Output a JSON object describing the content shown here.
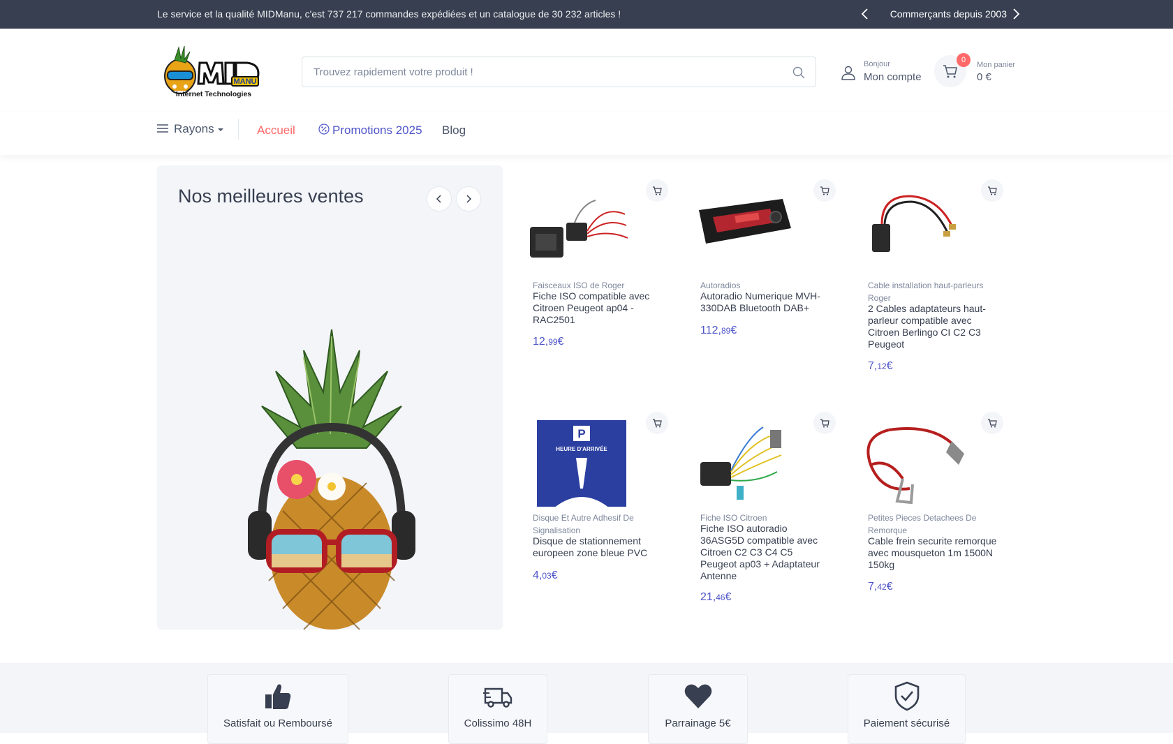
{
  "topbar": {
    "message": "Le service et la qualité MIDManu, c'est 737 217 commandes expédiées et un catalogue de 30 232 articles !",
    "since": "Commerçants depuis 2003"
  },
  "header": {
    "logo_text": "MIDManu Internet Technologies",
    "search_placeholder": "Trouvez rapidement votre produit !",
    "account_greeting": "Bonjour",
    "account_label": "Mon compte",
    "cart_label": "Mon panier",
    "cart_total": "0 €",
    "cart_count": "0"
  },
  "nav": {
    "rayons": "Rayons",
    "accueil": "Accueil",
    "promotions": "Promotions 2025",
    "blog": "Blog"
  },
  "bestsellers": {
    "title": "Nos meilleures ventes"
  },
  "products": [
    {
      "category": "Faisceaux ISO de Roger",
      "name": "Fiche ISO compatible avec Citroen Peugeot ap04 - RAC2501",
      "price_int": "12,",
      "price_cents": "99",
      "currency": "€",
      "icon": "iso-harness-image"
    },
    {
      "category": "Autoradios",
      "name": "Autoradio Numerique MVH-330DAB Bluetooth DAB+",
      "price_int": "112,",
      "price_cents": "89",
      "currency": "€",
      "icon": "car-radio-image"
    },
    {
      "category": "Cable installation haut-parleurs Roger",
      "name": "2 Cables adaptateurs haut-parleur compatible avec Citroen Berlingo CI C2 C3 Peugeot",
      "price_int": "7,",
      "price_cents": "12",
      "currency": "€",
      "icon": "speaker-cable-image"
    },
    {
      "category": "Disque Et Autre Adhesif De Signalisation",
      "name": "Disque de stationnement europeen zone bleue PVC",
      "price_int": "4,",
      "price_cents": "03",
      "currency": "€",
      "icon": "parking-disc-image",
      "disc_text": "HEURE D'ARRIVÉE",
      "disc_letter": "P"
    },
    {
      "category": "Fiche ISO Citroen",
      "name": "Fiche ISO autoradio 36ASG5D compatible avec Citroen C2 C3 C4 C5 Peugeot ap03 + Adaptateur Antenne",
      "price_int": "21,",
      "price_cents": "46",
      "currency": "€",
      "icon": "iso-antenna-adapter-image"
    },
    {
      "category": "Petites Pieces Detachees De Remorque",
      "name": "Cable frein securite remorque avec mousqueton 1m 1500N 150kg",
      "price_int": "7,",
      "price_cents": "42",
      "currency": "€",
      "icon": "brake-cable-image"
    }
  ],
  "features": [
    {
      "label": "Satisfait ou Remboursé",
      "icon": "thumbs-up-icon"
    },
    {
      "label": "Colissimo 48H",
      "icon": "delivery-truck-icon"
    },
    {
      "label": "Parrainage 5€",
      "icon": "heart-icon"
    },
    {
      "label": "Paiement sécurisé",
      "icon": "shield-check-icon"
    }
  ],
  "colors": {
    "topbar": "#373f50",
    "accent": "#fe696a",
    "price": "#4e54c8",
    "panel": "#f3f5f9"
  }
}
